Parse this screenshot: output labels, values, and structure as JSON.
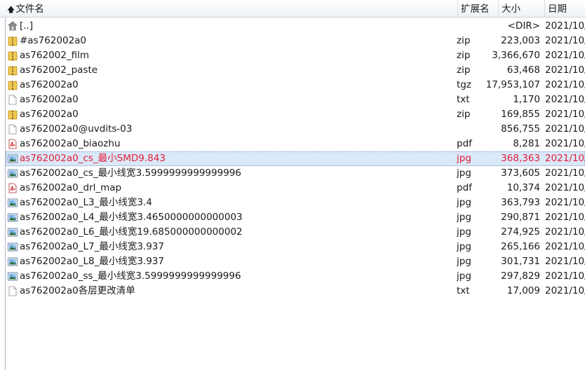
{
  "columns": {
    "name": "文件名",
    "ext": "扩展名",
    "size": "大小",
    "date": "日期"
  },
  "files": [
    {
      "name": "[..]",
      "ext": "",
      "size": "<DIR>",
      "date": "2021/10/",
      "icon": "up-folder-icon",
      "selected": false
    },
    {
      "name": "#as762002a0",
      "ext": "zip",
      "size": "223,003",
      "date": "2021/10/",
      "icon": "zip-archive-icon",
      "selected": false
    },
    {
      "name": "as762002_film",
      "ext": "zip",
      "size": "3,366,670",
      "date": "2021/10/",
      "icon": "zip-archive-icon",
      "selected": false
    },
    {
      "name": "as762002_paste",
      "ext": "zip",
      "size": "63,468",
      "date": "2021/10/",
      "icon": "zip-archive-icon",
      "selected": false
    },
    {
      "name": "as762002a0",
      "ext": "tgz",
      "size": "17,953,107",
      "date": "2021/10/",
      "icon": "zip-archive-icon",
      "selected": false
    },
    {
      "name": "as762002a0",
      "ext": "txt",
      "size": "1,170",
      "date": "2021/10/",
      "icon": "text-file-icon",
      "selected": false
    },
    {
      "name": "as762002a0",
      "ext": "zip",
      "size": "169,855",
      "date": "2021/10/",
      "icon": "zip-archive-icon",
      "selected": false
    },
    {
      "name": "as762002a0@uvdits-03",
      "ext": "",
      "size": "856,755",
      "date": "2021/10/",
      "icon": "text-file-icon",
      "selected": false
    },
    {
      "name": "as762002a0_biaozhu",
      "ext": "pdf",
      "size": "8,281",
      "date": "2021/10/",
      "icon": "pdf-file-icon",
      "selected": false
    },
    {
      "name": "as762002a0_cs_最小SMD9.843",
      "ext": "jpg",
      "size": "368,363",
      "date": "2021/10/",
      "icon": "image-file-icon",
      "selected": true
    },
    {
      "name": "as762002a0_cs_最小线宽3.5999999999999996",
      "ext": "jpg",
      "size": "373,605",
      "date": "2021/10/",
      "icon": "image-file-icon",
      "selected": false
    },
    {
      "name": "as762002a0_drl_map",
      "ext": "pdf",
      "size": "10,374",
      "date": "2021/10/",
      "icon": "pdf-file-icon",
      "selected": false
    },
    {
      "name": "as762002a0_L3_最小线宽3.4",
      "ext": "jpg",
      "size": "363,793",
      "date": "2021/10/",
      "icon": "image-file-icon",
      "selected": false
    },
    {
      "name": "as762002a0_L4_最小线宽3.4650000000000003",
      "ext": "jpg",
      "size": "290,871",
      "date": "2021/10/",
      "icon": "image-file-icon",
      "selected": false
    },
    {
      "name": "as762002a0_L6_最小线宽19.685000000000002",
      "ext": "jpg",
      "size": "274,925",
      "date": "2021/10/",
      "icon": "image-file-icon",
      "selected": false
    },
    {
      "name": "as762002a0_L7_最小线宽3.937",
      "ext": "jpg",
      "size": "265,166",
      "date": "2021/10/",
      "icon": "image-file-icon",
      "selected": false
    },
    {
      "name": "as762002a0_L8_最小线宽3.937",
      "ext": "jpg",
      "size": "301,731",
      "date": "2021/10/",
      "icon": "image-file-icon",
      "selected": false
    },
    {
      "name": "as762002a0_ss_最小线宽3.5999999999999996",
      "ext": "jpg",
      "size": "297,829",
      "date": "2021/10/",
      "icon": "image-file-icon",
      "selected": false
    },
    {
      "name": "as762002a0各层更改清单",
      "ext": "txt",
      "size": "17,009",
      "date": "2021/10/",
      "icon": "text-file-icon",
      "selected": false
    }
  ]
}
